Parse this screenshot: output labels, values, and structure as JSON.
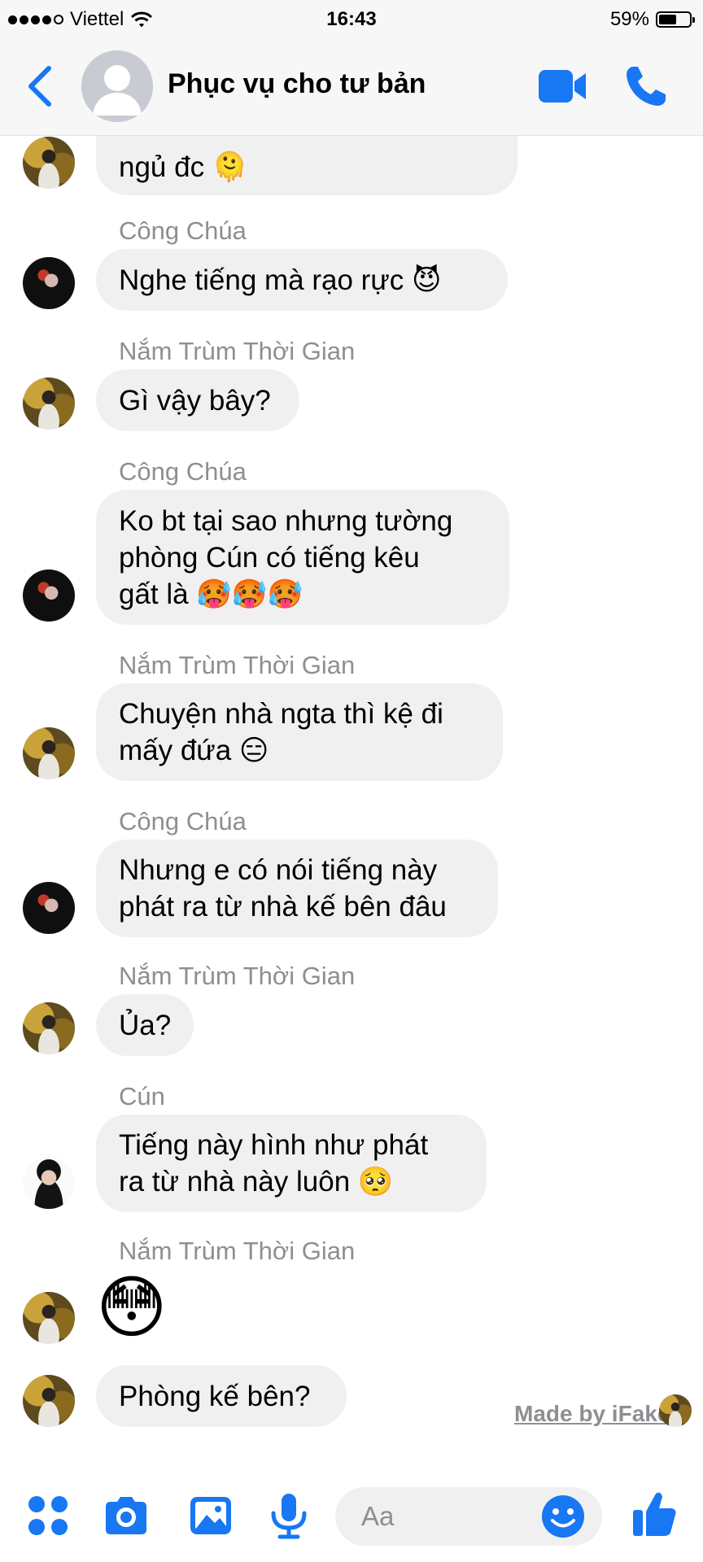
{
  "status_bar": {
    "carrier": "Viettel",
    "time": "16:43",
    "battery": "59%",
    "battery_level": 0.59
  },
  "header": {
    "title": "Phục vụ cho tư bản"
  },
  "messages": [
    {
      "sender": "",
      "text": "ngủ đc 🫠"
    },
    {
      "sender": "Công Chúa",
      "text": "Nghe tiếng mà rạo rực 😈"
    },
    {
      "sender": "Nắm Trùm Thời Gian",
      "text": "Gì vậy bây?"
    },
    {
      "sender": "Công Chúa",
      "text": "Ko bt tại sao nhưng tường\nphòng Cún có tiếng kêu\ngất là 🥵🥵🥵"
    },
    {
      "sender": "Nắm Trùm Thời Gian",
      "text": "Chuyện nhà ngta thì kệ đi\nmấy đứa 😑"
    },
    {
      "sender": "Công Chúa",
      "text": "Nhưng e có nói tiếng này\nphát ra từ nhà kế bên đâu"
    },
    {
      "sender": "Nắm Trùm Thời Gian",
      "text": "Ủa?"
    },
    {
      "sender": "Cún",
      "text": "Tiếng này hình như phát\nra từ nhà này luôn 🥺"
    },
    {
      "sender": "Nắm Trùm Thời Gian",
      "text": "😳"
    },
    {
      "sender": "",
      "text": "Phòng kế bên?"
    }
  ],
  "watermark": "Made by iFake",
  "composer": {
    "placeholder": "Aa"
  },
  "colors": {
    "accent": "#1877f2",
    "bubble": "#f0f0f0",
    "sender": "#8e8e93"
  },
  "icons": [
    "back-chevron-icon",
    "video-camera-icon",
    "phone-icon",
    "apps-icon",
    "camera-icon",
    "gallery-icon",
    "microphone-icon",
    "emoji-icon",
    "like-icon"
  ]
}
